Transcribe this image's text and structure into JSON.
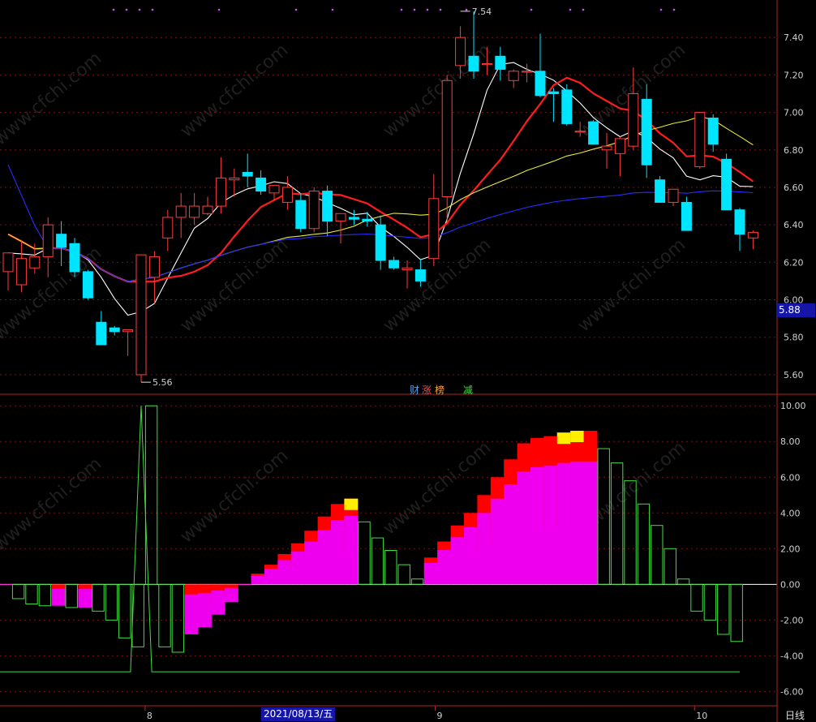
{
  "chart_data": [
    {
      "type": "candlestick",
      "ylim": [
        5.5,
        7.6
      ],
      "y_ticks": [
        "7.40",
        "7.20",
        "7.00",
        "6.80",
        "6.60",
        "6.40",
        "6.20",
        "6.00",
        "5.80",
        "5.60"
      ],
      "y_tick_values": [
        7.4,
        7.2,
        7.0,
        6.8,
        6.6,
        6.4,
        6.2,
        6.0,
        5.8,
        5.6
      ],
      "current_price": "5.88",
      "annotations": [
        {
          "text": "7.54",
          "x_index": 34,
          "y": 7.54
        },
        {
          "text": "5.56",
          "x_index": 10,
          "y": 5.56
        }
      ],
      "candles": [
        {
          "o": 6.15,
          "h": 6.23,
          "l": 6.05,
          "c": 6.25
        },
        {
          "o": 6.08,
          "h": 6.32,
          "l": 6.04,
          "c": 6.22
        },
        {
          "o": 6.17,
          "h": 6.3,
          "l": 6.14,
          "c": 6.23
        },
        {
          "o": 6.23,
          "h": 6.44,
          "l": 6.12,
          "c": 6.4
        },
        {
          "o": 6.35,
          "h": 6.42,
          "l": 6.18,
          "c": 6.28
        },
        {
          "o": 6.3,
          "h": 6.33,
          "l": 6.12,
          "c": 6.15
        },
        {
          "o": 6.15,
          "h": 6.16,
          "l": 6.0,
          "c": 6.01
        },
        {
          "o": 5.88,
          "h": 5.94,
          "l": 5.78,
          "c": 5.76
        },
        {
          "o": 5.85,
          "h": 5.86,
          "l": 5.81,
          "c": 5.83
        },
        {
          "o": 5.83,
          "h": 5.84,
          "l": 5.7,
          "c": 5.84
        },
        {
          "o": 5.6,
          "h": 6.24,
          "l": 5.56,
          "c": 6.24
        },
        {
          "o": 6.12,
          "h": 6.26,
          "l": 5.98,
          "c": 6.23
        },
        {
          "o": 6.33,
          "h": 6.48,
          "l": 6.26,
          "c": 6.44
        },
        {
          "o": 6.44,
          "h": 6.57,
          "l": 6.33,
          "c": 6.5
        },
        {
          "o": 6.44,
          "h": 6.57,
          "l": 6.4,
          "c": 6.5
        },
        {
          "o": 6.46,
          "h": 6.55,
          "l": 6.45,
          "c": 6.5
        },
        {
          "o": 6.5,
          "h": 6.76,
          "l": 6.46,
          "c": 6.65
        },
        {
          "o": 6.64,
          "h": 6.7,
          "l": 6.55,
          "c": 6.65
        },
        {
          "o": 6.68,
          "h": 6.78,
          "l": 6.6,
          "c": 6.66
        },
        {
          "o": 6.65,
          "h": 6.69,
          "l": 6.56,
          "c": 6.58
        },
        {
          "o": 6.57,
          "h": 6.61,
          "l": 6.53,
          "c": 6.61
        },
        {
          "o": 6.52,
          "h": 6.66,
          "l": 6.48,
          "c": 6.6
        },
        {
          "o": 6.53,
          "h": 6.57,
          "l": 6.36,
          "c": 6.38
        },
        {
          "o": 6.38,
          "h": 6.6,
          "l": 6.36,
          "c": 6.58
        },
        {
          "o": 6.58,
          "h": 6.61,
          "l": 6.34,
          "c": 6.42
        },
        {
          "o": 6.42,
          "h": 6.46,
          "l": 6.3,
          "c": 6.46
        },
        {
          "o": 6.44,
          "h": 6.48,
          "l": 6.4,
          "c": 6.43
        },
        {
          "o": 6.43,
          "h": 6.47,
          "l": 6.39,
          "c": 6.42
        },
        {
          "o": 6.4,
          "h": 6.45,
          "l": 6.16,
          "c": 6.21
        },
        {
          "o": 6.21,
          "h": 6.23,
          "l": 6.16,
          "c": 6.17
        },
        {
          "o": 6.16,
          "h": 6.21,
          "l": 6.06,
          "c": 6.17
        },
        {
          "o": 6.16,
          "h": 6.22,
          "l": 6.07,
          "c": 6.1
        },
        {
          "o": 6.22,
          "h": 6.67,
          "l": 6.18,
          "c": 6.54
        },
        {
          "o": 6.55,
          "h": 7.2,
          "l": 6.41,
          "c": 7.17
        },
        {
          "o": 7.25,
          "h": 7.46,
          "l": 7.18,
          "c": 7.4
        },
        {
          "o": 7.3,
          "h": 7.54,
          "l": 7.18,
          "c": 7.22
        },
        {
          "o": 7.26,
          "h": 7.35,
          "l": 7.2,
          "c": 7.26
        },
        {
          "o": 7.3,
          "h": 7.35,
          "l": 7.17,
          "c": 7.23
        },
        {
          "o": 7.17,
          "h": 7.23,
          "l": 7.13,
          "c": 7.22
        },
        {
          "o": 7.22,
          "h": 7.26,
          "l": 7.16,
          "c": 7.22
        },
        {
          "o": 7.22,
          "h": 7.42,
          "l": 7.08,
          "c": 7.09
        },
        {
          "o": 7.11,
          "h": 7.13,
          "l": 6.95,
          "c": 7.1
        },
        {
          "o": 7.12,
          "h": 7.15,
          "l": 6.93,
          "c": 6.94
        },
        {
          "o": 6.9,
          "h": 6.95,
          "l": 6.87,
          "c": 6.9
        },
        {
          "o": 6.95,
          "h": 6.96,
          "l": 6.83,
          "c": 6.83
        },
        {
          "o": 6.8,
          "h": 6.89,
          "l": 6.7,
          "c": 6.82
        },
        {
          "o": 6.78,
          "h": 6.87,
          "l": 6.66,
          "c": 6.86
        },
        {
          "o": 6.82,
          "h": 7.24,
          "l": 6.8,
          "c": 7.1
        },
        {
          "o": 7.07,
          "h": 7.15,
          "l": 6.65,
          "c": 6.72
        },
        {
          "o": 6.64,
          "h": 6.66,
          "l": 6.53,
          "c": 6.52
        },
        {
          "o": 6.52,
          "h": 6.59,
          "l": 6.5,
          "c": 6.59
        },
        {
          "o": 6.52,
          "h": 6.55,
          "l": 6.37,
          "c": 6.37
        },
        {
          "o": 6.71,
          "h": 7.0,
          "l": 6.7,
          "c": 7.0
        },
        {
          "o": 6.97,
          "h": 6.99,
          "l": 6.79,
          "c": 6.83
        },
        {
          "o": 6.75,
          "h": 6.78,
          "l": 6.48,
          "c": 6.48
        },
        {
          "o": 6.48,
          "h": 6.49,
          "l": 6.26,
          "c": 6.35
        },
        {
          "o": 6.33,
          "h": 6.37,
          "l": 6.27,
          "c": 6.36
        }
      ],
      "series": [
        {
          "color": "#ffffff"
        },
        {
          "color": "#ff1c1c"
        },
        {
          "color": "#e8e83a"
        },
        {
          "color": "#2b2bff"
        }
      ],
      "top_markers": [
        "财",
        "涨",
        "榜",
        "减"
      ]
    },
    {
      "type": "indicator_bars",
      "ylim": [
        -6.8,
        10.6
      ],
      "y_ticks": [
        "10.00",
        "8.00",
        "6.00",
        "4.00",
        "2.00",
        "0.00",
        "-2.00",
        "-4.00",
        "-6.00"
      ],
      "y_tick_values": [
        10,
        8,
        6,
        4,
        2,
        0,
        -2,
        -4,
        -6
      ],
      "values": [
        0,
        -0.8,
        -1.1,
        -1.2,
        -1.2,
        -1.3,
        -1.3,
        -1.5,
        -2.0,
        -3.0,
        -3.5,
        10.0,
        -3.5,
        -3.8,
        -2.8,
        -2.4,
        -1.7,
        -1.0,
        0,
        0.6,
        1.1,
        1.7,
        2.3,
        3.0,
        3.8,
        4.5,
        4.8,
        3.5,
        2.6,
        1.9,
        1.1,
        0.3,
        1.5,
        2.4,
        3.3,
        4.0,
        5.0,
        6.0,
        7.0,
        7.9,
        8.2,
        8.3,
        8.5,
        8.6,
        8.6,
        7.6,
        6.8,
        5.8,
        4.5,
        3.3,
        2.0,
        0.3,
        -1.5,
        -2.0,
        -2.8,
        -3.2
      ],
      "signal_line": -4.9,
      "date_label": "2021/08/13/五",
      "x_ticks": [
        "8",
        "9",
        "10"
      ],
      "period": "日线"
    }
  ]
}
